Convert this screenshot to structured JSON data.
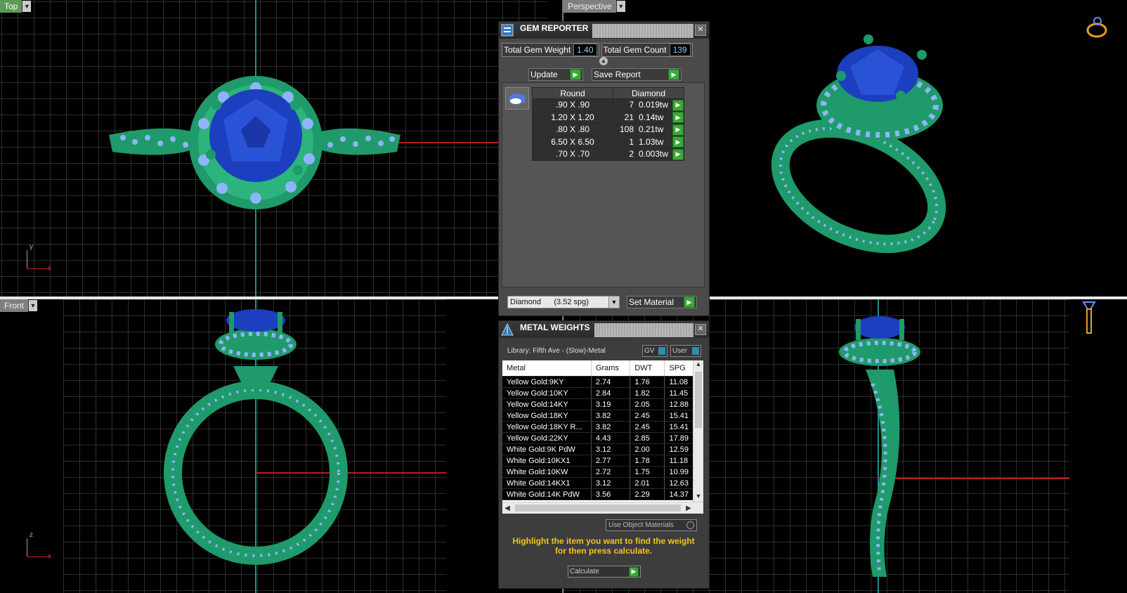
{
  "viewports": {
    "top": {
      "label": "Top",
      "axis_v": "y",
      "axis_h": "x"
    },
    "perspective": {
      "label": "Perspective"
    },
    "front": {
      "label": "Front",
      "axis_v": "z",
      "axis_h": "x"
    },
    "right": {
      "label": ""
    }
  },
  "gem_reporter": {
    "title": "GEM REPORTER",
    "total_weight_label": "Total Gem Weight",
    "total_weight_value": "1.40",
    "total_count_label": "Total Gem Count",
    "total_count_value": "139",
    "update_label": "Update",
    "save_report_label": "Save Report",
    "col_shape": "Round",
    "col_material": "Diamond",
    "rows": [
      {
        "size": ".90 X .90",
        "count": "7",
        "weight": "0.019tw"
      },
      {
        "size": "1.20 X 1.20",
        "count": "21",
        "weight": "0.14tw"
      },
      {
        "size": ".80 X .80",
        "count": "108",
        "weight": "0.21tw"
      },
      {
        "size": "6.50 X 6.50",
        "count": "1",
        "weight": "1.03tw"
      },
      {
        "size": ".70 X .70",
        "count": "2",
        "weight": "0.003tw"
      }
    ],
    "material_select": "Diamond      (3.52 spg)",
    "set_material_label": "Set Material"
  },
  "metal_weights": {
    "title": "METAL WEIGHTS",
    "library": "Library: Fifth Ave - (Slow)-Metal",
    "toggle_gv": "GV",
    "toggle_user": "User",
    "columns": [
      "Metal",
      "Grams",
      "DWT",
      "SPG"
    ],
    "rows": [
      [
        "Yellow Gold:9KY",
        "2.74",
        "1.76",
        "11.08"
      ],
      [
        "Yellow Gold:10KY",
        "2.84",
        "1.82",
        "11.45"
      ],
      [
        "Yellow Gold:14KY",
        "3.19",
        "2.05",
        "12.88"
      ],
      [
        "Yellow Gold:18KY",
        "3.82",
        "2.45",
        "15.41"
      ],
      [
        "Yellow Gold:18KY R...",
        "3.82",
        "2.45",
        "15.41"
      ],
      [
        "Yellow Gold:22KY",
        "4.43",
        "2.85",
        "17.89"
      ],
      [
        "White Gold:9K PdW",
        "3.12",
        "2.00",
        "12.59"
      ],
      [
        "White Gold:10KX1",
        "2.77",
        "1.78",
        "11.18"
      ],
      [
        "White Gold:10KW",
        "2.72",
        "1.75",
        "10.99"
      ],
      [
        "White Gold:14KX1",
        "3.12",
        "2.01",
        "12.63"
      ],
      [
        "White Gold:14K PdW",
        "3.56",
        "2.29",
        "14.37"
      ]
    ],
    "use_object_materials": "Use Object Materials",
    "hint": "Highlight the item you want to find the weight for then press calculate.",
    "calculate_label": "Calculate"
  },
  "colors": {
    "ring_green": "#1f9a6a",
    "stone_blue": "#1c3fbf",
    "pave_light": "#8fb4ff",
    "grid": "#5a5a5a",
    "hint_yellow": "#f5c518"
  }
}
